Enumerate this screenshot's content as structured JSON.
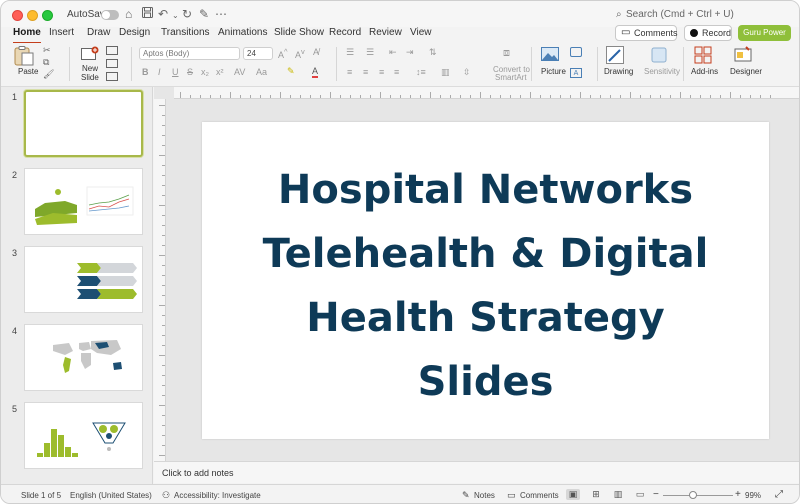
{
  "titlebar": {
    "autosave_label": "AutoSave",
    "search_placeholder": "Search (Cmd + Ctrl + U)"
  },
  "tabs": [
    {
      "label": "Home",
      "active": true
    },
    {
      "label": "Insert"
    },
    {
      "label": "Draw"
    },
    {
      "label": "Design"
    },
    {
      "label": "Transitions"
    },
    {
      "label": "Animations"
    },
    {
      "label": "Slide Show"
    },
    {
      "label": "Record"
    },
    {
      "label": "Review"
    },
    {
      "label": "View"
    }
  ],
  "header_buttons": {
    "comments": "Comments",
    "record": "Record",
    "guru": "Guru Power"
  },
  "ribbon": {
    "paste": "Paste",
    "new_slide_1": "New",
    "new_slide_2": "Slide",
    "font_name": "Aptos (Body)",
    "font_size": "24",
    "convert_1": "Convert to",
    "convert_2": "SmartArt",
    "picture": "Picture",
    "drawing": "Drawing",
    "sensitivity": "Sensitivity",
    "addins": "Add-ins",
    "designer": "Designer",
    "accent": "#c43e1c"
  },
  "slides": [
    {
      "number": "1"
    },
    {
      "number": "2"
    },
    {
      "number": "3"
    },
    {
      "number": "4"
    },
    {
      "number": "5"
    }
  ],
  "main_slide": {
    "title_lines": [
      "Hospital Networks",
      "Telehealth & Digital",
      "Health Strategy",
      "Slides"
    ],
    "title_color": "#0e3a57"
  },
  "notes_placeholder": "Click to add notes",
  "status": {
    "slide_info": "Slide 1 of 5",
    "language": "English (United States)",
    "accessibility": "Accessibility: Investigate",
    "notes": "Notes",
    "comments": "Comments",
    "zoom": "99%"
  }
}
